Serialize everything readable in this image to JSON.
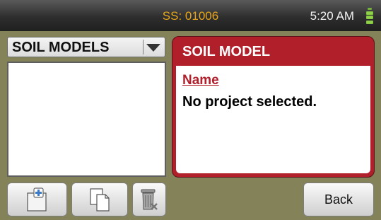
{
  "status_bar": {
    "serial": "SS: 01006",
    "time": "5:20 AM",
    "battery_level": 1.0,
    "colors": {
      "serial": "#e6a61c",
      "battery": "#8fd24a"
    }
  },
  "left_panel": {
    "dropdown": {
      "selected": "SOIL MODELS"
    },
    "list": {
      "items": []
    }
  },
  "toolbar": {
    "add_icon": "add-document-icon",
    "copy_icon": "copy-document-icon",
    "delete_icon": "trash-delete-icon",
    "back_label": "Back"
  },
  "detail_card": {
    "title": "SOIL MODEL",
    "field_label": "Name",
    "field_value": "No project selected.",
    "accent": "#b11f2b"
  }
}
